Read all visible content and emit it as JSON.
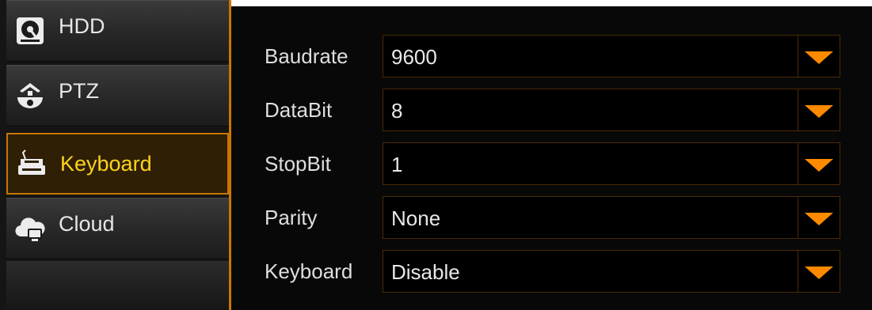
{
  "sidebar": {
    "items": [
      {
        "label": "HDD",
        "icon": "hdd-icon"
      },
      {
        "label": "PTZ",
        "icon": "ptz-camera-icon"
      },
      {
        "label": "Keyboard",
        "icon": "keyboard-icon",
        "active": true
      },
      {
        "label": "Cloud",
        "icon": "cloud-icon"
      }
    ]
  },
  "settings": {
    "fields": [
      {
        "label": "Baudrate",
        "value": "9600"
      },
      {
        "label": "DataBit",
        "value": "8"
      },
      {
        "label": "StopBit",
        "value": "1"
      },
      {
        "label": "Parity",
        "value": "None"
      },
      {
        "label": "Keyboard",
        "value": "Disable"
      }
    ]
  },
  "colors": {
    "accent": "#ff8a00",
    "active_text": "#ffd21c",
    "active_border": "#c77600",
    "panel_bg": "#080808"
  }
}
